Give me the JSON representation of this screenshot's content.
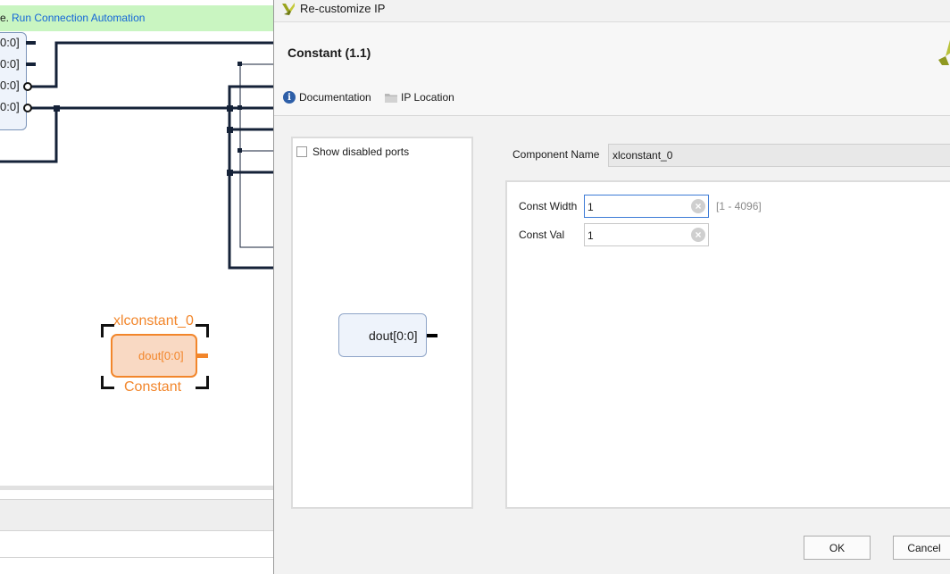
{
  "canvas": {
    "banner_prefix": "e.",
    "banner_link": "Run Connection Automation",
    "pin_labels": [
      "0:0]",
      "0:0]",
      "0:0]",
      "0:0]"
    ],
    "constant_block": {
      "instance_name": "xlconstant_0",
      "pin": "dout[0:0]",
      "type_label": "Constant",
      "color": "#f2862b"
    }
  },
  "dialog": {
    "title": "Re-customize IP",
    "ip_title": "Constant (1.1)",
    "links": {
      "documentation": "Documentation",
      "ip_location": "IP Location"
    },
    "symbol": {
      "show_disabled_ports": "Show disabled ports",
      "pin": "dout[0:0]"
    },
    "component_name_label": "Component Name",
    "component_name_value": "xlconstant_0",
    "params": {
      "const_width_label": "Const Width",
      "const_width_value": "1",
      "const_width_range": "[1 - 4096]",
      "const_val_label": "Const Val",
      "const_val_value": "1"
    },
    "buttons": {
      "ok": "OK",
      "cancel": "Cancel"
    }
  }
}
